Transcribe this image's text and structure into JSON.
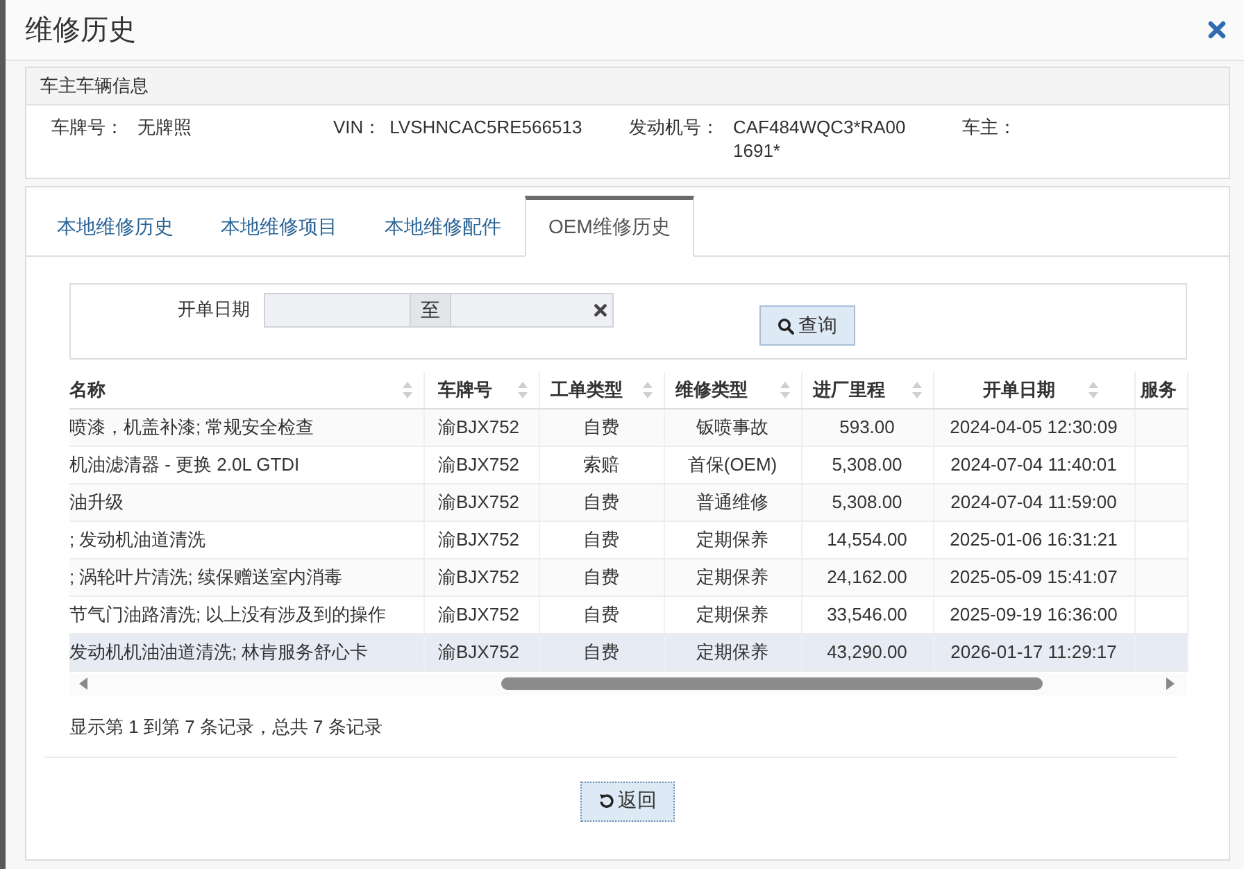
{
  "dialog": {
    "title": "维修历史"
  },
  "vehicle_info": {
    "heading": "车主车辆信息",
    "fields": [
      {
        "label": "车牌号：",
        "value": "无牌照"
      },
      {
        "label": "VIN：",
        "value": "LVSHNCAC5RE566513"
      },
      {
        "label": "发动机号：",
        "value": "CAF484WQC3*RA001691*"
      },
      {
        "label": "车主："
      }
    ]
  },
  "tabs": [
    {
      "label": "本地维修历史",
      "selected": false
    },
    {
      "label": "本地维修项目",
      "selected": false
    },
    {
      "label": "本地维修配件",
      "selected": false
    },
    {
      "label": "OEM维修历史",
      "selected": true
    }
  ],
  "search": {
    "label": "开单日期",
    "range_separator": "至",
    "button": "查询"
  },
  "table": {
    "columns": [
      "名称",
      "车牌号",
      "工单类型",
      "维修类型",
      "进厂里程",
      "开单日期",
      "服务"
    ],
    "rows": [
      {
        "cells": [
          "喷漆，机盖补漆; 常规安全检查",
          "渝BJX752",
          "自费",
          "钣喷事故",
          "593.00",
          "2024-04-05 12:30:09"
        ],
        "selected": false
      },
      {
        "cells": [
          "机油滤清器 - 更换 2.0L GTDI",
          "渝BJX752",
          "索赔",
          "首保(OEM)",
          "5,308.00",
          "2024-07-04 11:40:01"
        ],
        "selected": false
      },
      {
        "cells": [
          "油升级",
          "渝BJX752",
          "自费",
          "普通维修",
          "5,308.00",
          "2024-07-04 11:59:00"
        ],
        "selected": false
      },
      {
        "cells": [
          "; 发动机油道清洗",
          "渝BJX752",
          "自费",
          "定期保养",
          "14,554.00",
          "2025-01-06 16:31:21"
        ],
        "selected": false
      },
      {
        "cells": [
          "; 涡轮叶片清洗; 续保赠送室内消毒",
          "渝BJX752",
          "自费",
          "定期保养",
          "24,162.00",
          "2025-05-09 15:41:07"
        ],
        "selected": false
      },
      {
        "cells": [
          "节气门油路清洗; 以上没有涉及到的操作",
          "渝BJX752",
          "自费",
          "定期保养",
          "33,546.00",
          "2025-09-19 16:36:00"
        ],
        "selected": false
      },
      {
        "cells": [
          "发动机机油油道清洗; 林肯服务舒心卡",
          "渝BJX752",
          "自费",
          "定期保养",
          "43,290.00",
          "2026-01-17 11:29:17"
        ],
        "selected": true
      }
    ]
  },
  "footer": {
    "summary": "显示第 1 到第 7 条记录，总共 7 条记录",
    "button": "返回"
  }
}
